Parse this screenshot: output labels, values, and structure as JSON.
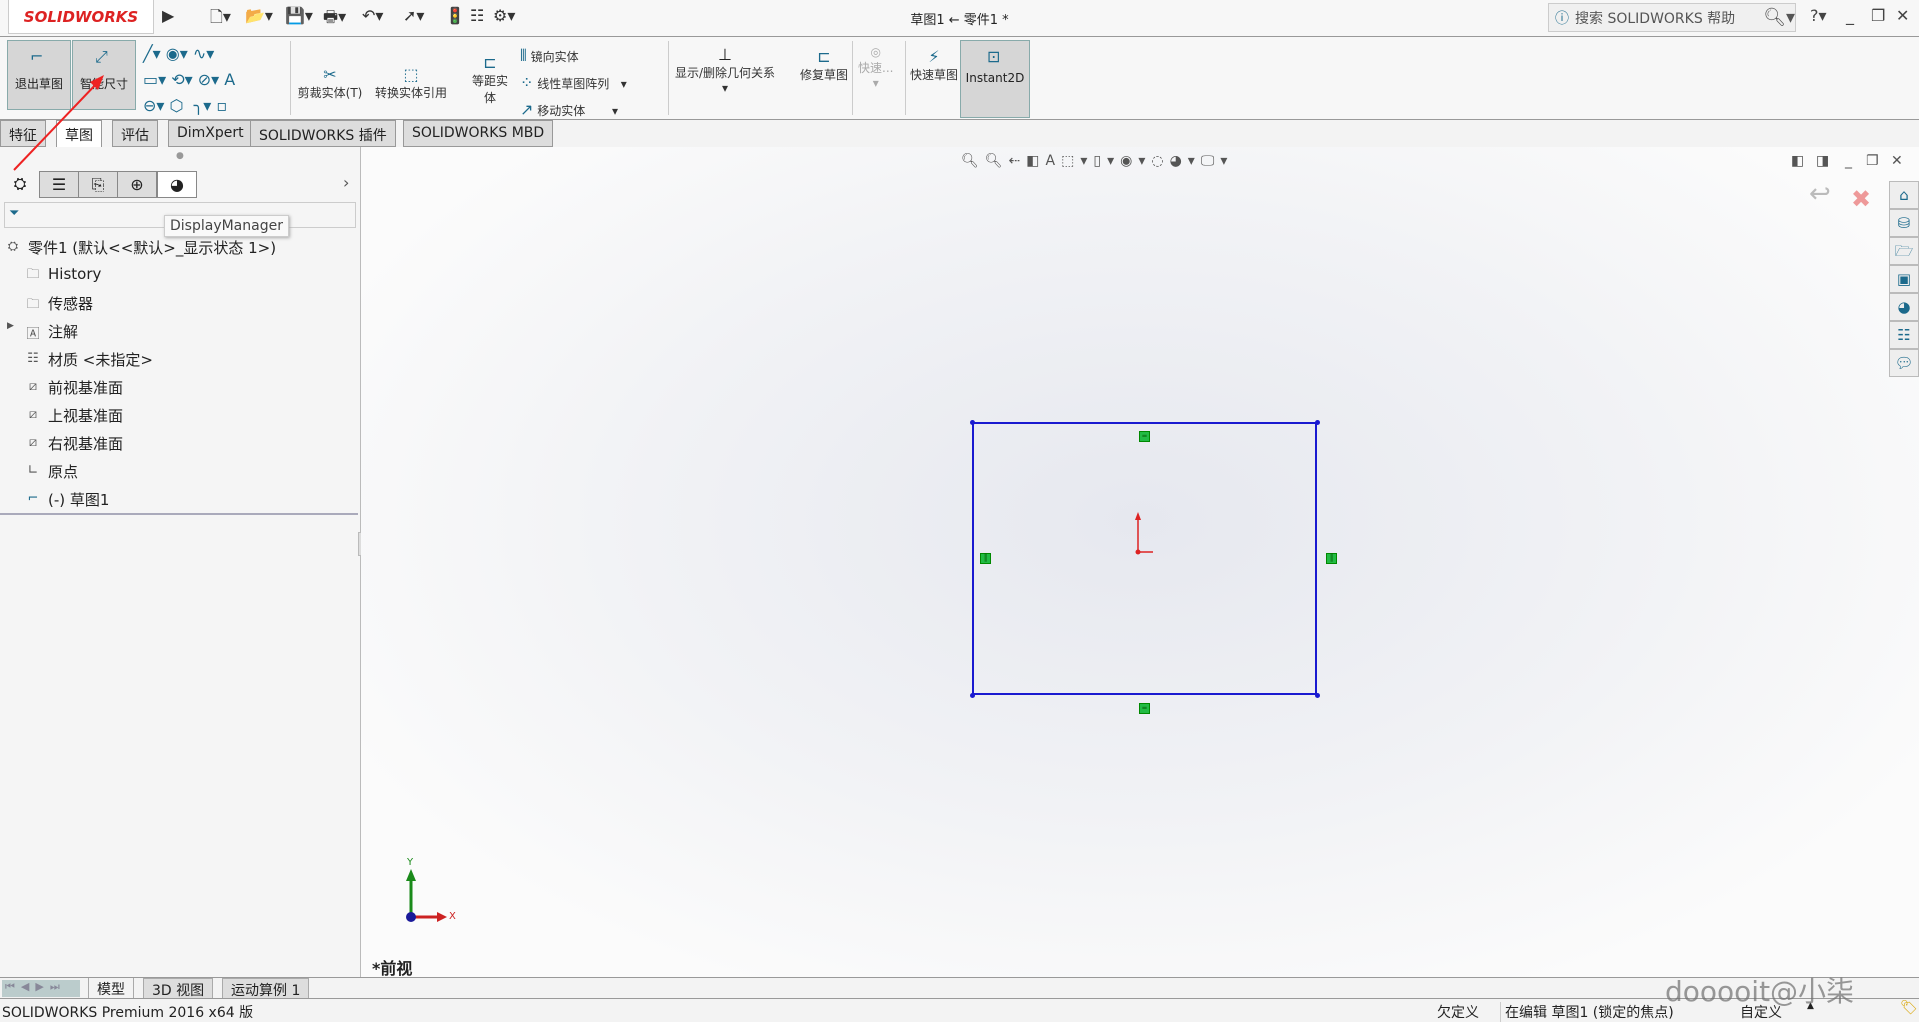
{
  "app": {
    "logo": "SOLIDWORKS",
    "title": "草图1 ← 零件1 *"
  },
  "search": {
    "placeholder": "搜索 SOLIDWORKS 帮助"
  },
  "commands": {
    "exit_sketch": "退出草图",
    "smart_dimension": "智能尺寸",
    "trim": "剪裁实体(T)",
    "convert": "转换实体引用",
    "offset": "等距实体",
    "mirror": "镜向实体",
    "linear_pattern": "线性草图阵列",
    "move": "移动实体",
    "relations": "显示/删除几何关系",
    "repair": "修复草图",
    "quick_snaps": "快速...",
    "rapid_sketch": "快速草图",
    "instant2d": "Instant2D"
  },
  "tabs": [
    "特征",
    "草图",
    "评估",
    "DimXpert",
    "SOLIDWORKS 插件",
    "SOLIDWORKS MBD"
  ],
  "active_tab": "草图",
  "panel": {
    "tooltip": "DisplayManager",
    "tree": [
      {
        "label": "零件1  (默认<<默认>_显示状态 1>)",
        "icon": "part-icon"
      },
      {
        "label": "History",
        "icon": "history-folder-icon"
      },
      {
        "label": "传感器",
        "icon": "sensor-folder-icon"
      },
      {
        "label": "注解",
        "icon": "annotation-folder-icon",
        "expandable": true
      },
      {
        "label": "材质 <未指定>",
        "icon": "material-icon"
      },
      {
        "label": "前视基准面",
        "icon": "plane-icon"
      },
      {
        "label": "上视基准面",
        "icon": "plane-icon"
      },
      {
        "label": "右视基准面",
        "icon": "plane-icon"
      },
      {
        "label": "原点",
        "icon": "origin-icon"
      },
      {
        "label": "(-) 草图1",
        "icon": "sketch-icon"
      }
    ]
  },
  "viewport": {
    "view_label": "*前视",
    "triad": {
      "x": "X",
      "y": "Y"
    },
    "sketch_color": "#1a1ad0",
    "relation_color": "#22bb44"
  },
  "bottom_tabs": [
    "模型",
    "3D 视图",
    "运动算例 1"
  ],
  "status": {
    "version": "SOLIDWORKS Premium 2016 x64 版",
    "definition": "欠定义",
    "editing": "在编辑 草图1 (锁定的焦点)",
    "units": "自定义"
  },
  "watermark": "dooooit@小柒"
}
